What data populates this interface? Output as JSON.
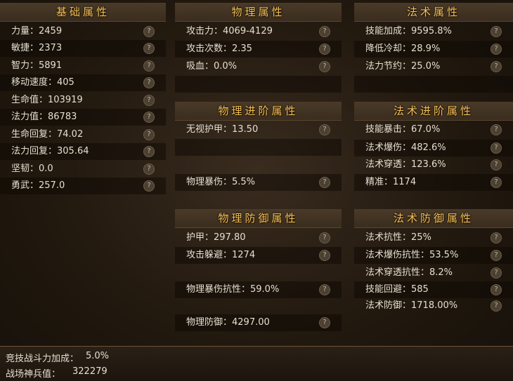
{
  "basic": {
    "title": "基础属性",
    "rows": [
      "力量：2459",
      "敏捷：2373",
      "智力：5891",
      "移动速度：405",
      "生命值：103919",
      "法力值：86783",
      "生命回复：74.02",
      "法力回复：305.64",
      "坚韧：0.0",
      "勇武：257.0"
    ]
  },
  "physical": {
    "title": "物理属性",
    "rows": [
      "攻击力：4069-4129",
      "攻击次数：2.35",
      "吸血：0.0%"
    ]
  },
  "magic": {
    "title": "法术属性",
    "rows": [
      "技能加成：9595.8%",
      "降低冷却：28.9%",
      "法力节约：25.0%"
    ]
  },
  "physical_adv": {
    "title": "物理进阶属性",
    "rows": [
      "无视护甲：13.50",
      "物理暴伤：5.5%"
    ]
  },
  "magic_adv": {
    "title": "法术进阶属性",
    "rows": [
      "技能暴击：67.0%",
      "法术爆伤：482.6%",
      "法术穿透：123.6%",
      "精准：1174"
    ]
  },
  "physical_def": {
    "title": "物理防御属性",
    "rows": [
      "护甲：297.80",
      "攻击躲避：1274",
      "物理暴伤抗性：59.0%",
      "物理防御：4297.00"
    ]
  },
  "magic_def": {
    "title": "法术防御属性",
    "rows": [
      "法术抗性：25%",
      "法术爆伤抗性：53.5%",
      "法术穿透抗性：8.2%",
      "技能回避：585",
      "法术防御：1718.00%"
    ]
  },
  "footer": {
    "arena_label": "竞技战斗力加成：",
    "arena_value": "5.0%",
    "artifact_label": "战场神兵值：",
    "artifact_value": "322279"
  },
  "help_glyph": "?"
}
